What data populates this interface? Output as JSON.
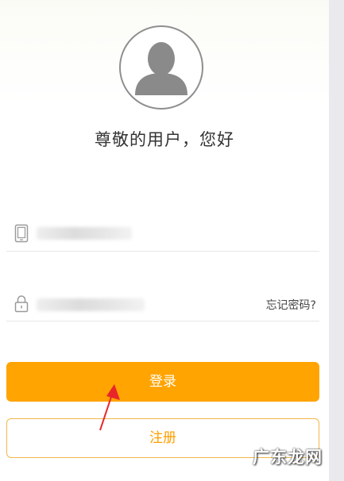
{
  "header": {
    "greeting": "尊敬的用户，您好"
  },
  "form": {
    "phone_icon": "phone-icon",
    "lock_icon": "lock-icon",
    "forgot_password": "忘记密码?"
  },
  "actions": {
    "login_label": "登录",
    "register_label": "注册"
  },
  "overlay": {
    "watermark": "广东龙网"
  },
  "colors": {
    "accent": "#ffa400",
    "register_border": "#f2b64b",
    "annotation": "#e8262a"
  }
}
